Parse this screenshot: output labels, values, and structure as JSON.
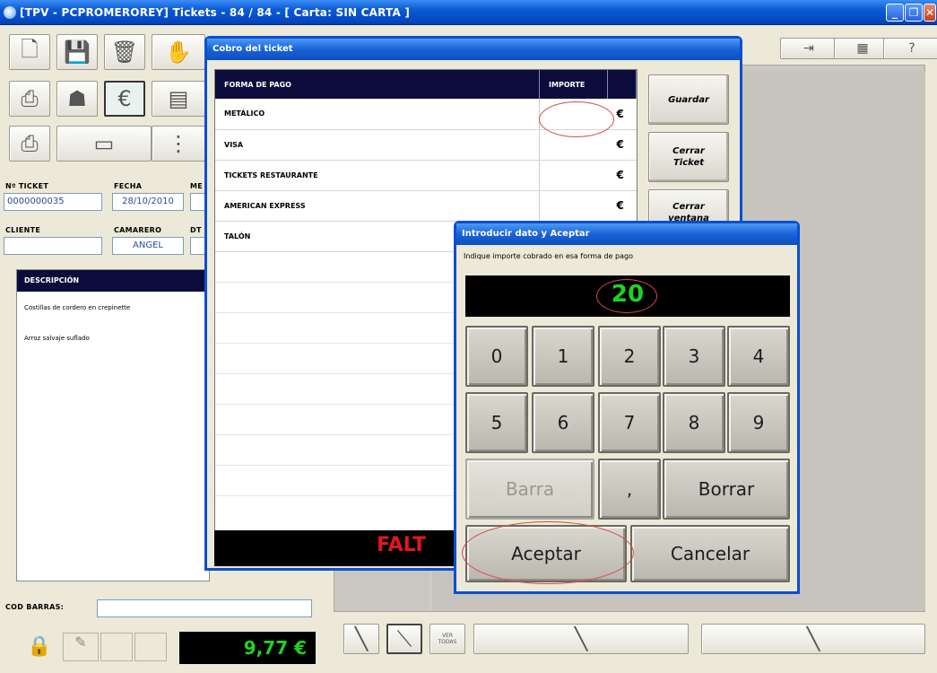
{
  "window": {
    "title": "[TPV - PCPROMEROREY] Tickets - 84 / 84 - [ Carta: SIN CARTA ]"
  },
  "ticket_panel": {
    "ticket_label": "Nº TICKET",
    "ticket_value": "0000000035",
    "fecha_label": "FECHA",
    "fecha_value": "28/10/2010",
    "mesa_label": "ME",
    "cliente_label": "CLIENTE",
    "cliente_value": "",
    "camarero_label": "CAMARERO",
    "camarero_value": "ANGEL",
    "dt_label": "DT",
    "desc_header": "DESCRIPCIÓN",
    "items": [
      "Costillas de cordero en crepinette",
      "Arroz salvaje suflado"
    ],
    "cod_barras_label": "COD BARRAS:",
    "total": "9,77 €"
  },
  "bottom_bar": {
    "ver_todas": "VER\nTODAS"
  },
  "cobro_dialog": {
    "title": "Cobro del ticket",
    "col_forma": "FORMA DE PAGO",
    "col_importe": "IMPORTE",
    "rows": [
      {
        "forma": "METÁLICO",
        "currency": "€"
      },
      {
        "forma": "VISA",
        "currency": "€"
      },
      {
        "forma": "TICKETS RESTAURANTE",
        "currency": "€"
      },
      {
        "forma": "AMERICAN EXPRESS",
        "currency": "€"
      },
      {
        "forma": "TALÓN",
        "currency": ""
      }
    ],
    "guardar": "Guardar",
    "cerrar_ticket": "Cerrar\nTicket",
    "cerrar_ventana": "Cerrar\nventana",
    "falta_text": "FALT"
  },
  "keypad_dialog": {
    "title": "Introducir dato y Aceptar",
    "instruction": "Indique importe cobrado en esa forma de pago",
    "display_value": "20",
    "keys": [
      "0",
      "1",
      "2",
      "3",
      "4",
      "5",
      "6",
      "7",
      "8",
      "9"
    ],
    "barra": "Barra",
    "comma": ",",
    "borrar": "Borrar",
    "aceptar": "Aceptar",
    "cancelar": "Cancelar"
  },
  "colors": {
    "accent": "#0a4fd2",
    "display_bg": "#000000",
    "display_fg": "#22d11f",
    "falta": "#e01818"
  }
}
